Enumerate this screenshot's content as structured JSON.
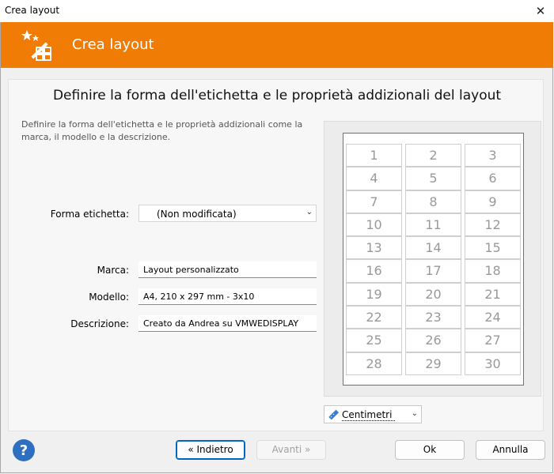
{
  "window": {
    "title": "Crea layout",
    "close_glyph": "✕"
  },
  "header": {
    "title": "Crea layout",
    "icon": "magic-wand-grid-icon",
    "accent_color": "#f07b05"
  },
  "main": {
    "heading": "Definire la forma dell'etichetta e le proprietà addizionali del layout",
    "description": "Definire la forma dell'etichetta e le proprietà addizionali come la marca, il modello e la descrizione."
  },
  "form": {
    "shape_label": "Forma etichetta:",
    "shape_value": "(Non modificata)",
    "brand_label": "Marca:",
    "brand_value": "Layout personalizzato",
    "model_label": "Modello:",
    "model_value": "A4, 210 x 297 mm - 3x10",
    "description_label": "Descrizione:",
    "description_value": "Creato da Andrea su VMWEDISPLAY"
  },
  "preview": {
    "labels": [
      "1",
      "2",
      "3",
      "4",
      "5",
      "6",
      "7",
      "8",
      "9",
      "10",
      "11",
      "12",
      "13",
      "14",
      "15",
      "16",
      "17",
      "18",
      "19",
      "20",
      "21",
      "22",
      "23",
      "24",
      "25",
      "26",
      "27",
      "28",
      "29",
      "30"
    ]
  },
  "units": {
    "value": "Centimetri",
    "icon": "ruler-icon"
  },
  "buttons": {
    "back": "« Indietro",
    "next": "Avanti »",
    "ok": "Ok",
    "cancel": "Annulla",
    "help_icon": "help-icon"
  }
}
